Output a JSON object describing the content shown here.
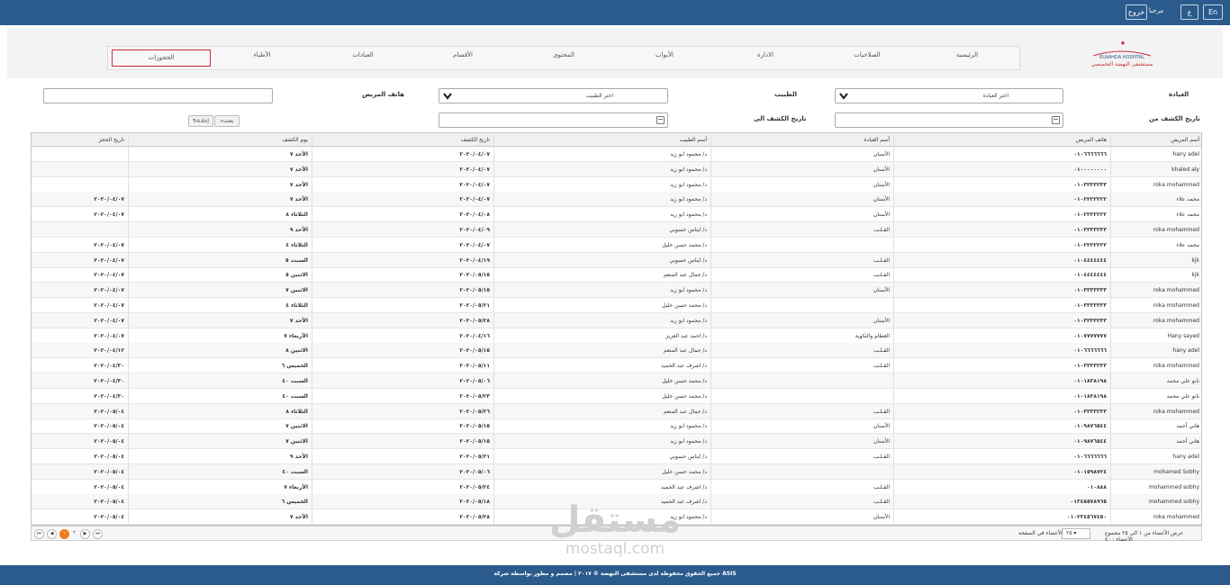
{
  "topbar": {
    "lang_en": "En",
    "lang_ar": "ع",
    "welcome": "مرحبا",
    "logout": "خروج"
  },
  "logo": {
    "text_en": "ELNAHDA HOSPITAL",
    "text_ar": "مستشفى النهضة التخصصي"
  },
  "nav": {
    "items": [
      {
        "label": "الرئيسية"
      },
      {
        "label": "الصلاحيات"
      },
      {
        "label": "الادارة"
      },
      {
        "label": "الأبواب"
      },
      {
        "label": "المحتوى"
      },
      {
        "label": "الأقسام"
      },
      {
        "label": "العيادات"
      },
      {
        "label": "الأطباء"
      },
      {
        "label": "الحجوزات"
      }
    ]
  },
  "filters": {
    "clinic_label": "العيادة",
    "clinic_value": "اختر العيادة",
    "doctor_label": "الطبيب",
    "doctor_value": "اختر الطبيب",
    "phone_label": "هاتف المريض",
    "date_from_label": "تاريخ الكشف من",
    "date_to_label": "تاريخ الكشف الى",
    "search_button": "بحث",
    "reset_button": "إعادة"
  },
  "table": {
    "columns": [
      "أسم المريض",
      "هاتف المريض",
      "أسم العيادة",
      "أسم الطبيب",
      "تاريخ الكشف",
      "يوم الكشف",
      "تاريخ الحجز"
    ],
    "rows": [
      [
        "hany adel",
        "٠١٠٦٦٦٦٦٦٦",
        "الأسنان",
        "د/ محمود ابو زيد",
        "٢٠٢٠/٠٤/٠٧",
        "الأحد ٧",
        ""
      ],
      [
        "khaled aly",
        "٠١٠٠٠٠٠٠٠٠",
        "الأسنان",
        "د/ محمود ابو زيد",
        "٢٠٢٠/٠٤/٠٧",
        "الأحد ٧",
        ""
      ],
      [
        "roka mohammed",
        "٠١٠٣٣٣٣٣٣٣",
        "الأسنان",
        "د/ محمود ابو زيد",
        "٢٠٢٠/٠٤/٠٧",
        "الأحد ٧",
        ""
      ],
      [
        "محمد علاء",
        "٠١٠٢٢٢٢٢٢٢",
        "الأسنان",
        "د/ محمود ابو زيد",
        "٢٠٢٠/٠٤/٠٧",
        "الأحد ٧",
        "٢٠٢٠/٠٤/٠٧"
      ],
      [
        "محمد علاء",
        "٠١٠٢٢٢٢٢٢٢",
        "الأسنان",
        "د/ محمود ابو زيد",
        "٢٠٢٠/٠٤/٠٨",
        "الثلاثاء ٨",
        "٢٠٢٠/٠٤/٠٧"
      ],
      [
        "roka mohammed",
        "٠١٠٣٣٣٣٣٣٣",
        "القـلـب",
        "د/ ايناس حسوبي",
        "٢٠٢٠/٠٤/٠٩",
        "الأحد ٩",
        ""
      ],
      [
        "محمد علاء",
        "٠١٠٢٢٢٢٢٢٢",
        "",
        "د/ محمد حسن خليل",
        "٢٠٢٠/٠٤/٠٧",
        "الثلاثاء ٤",
        "٢٠٢٠/٠٤/٠٧"
      ],
      [
        "kjk",
        "٠١٠٤٤٤٤٤٤٤",
        "القـلـب",
        "د/ ايناس حسوبي",
        "٢٠٢٠/٠٤/١٩",
        "السبت ٥",
        "٢٠٢٠/٠٤/٠٧"
      ],
      [
        "kjk",
        "٠١٠٤٤٤٤٤٤٤",
        "القـلـب",
        "د/ جمال عبد المنعم",
        "٢٠٢٠/٠٥/١٥",
        "الاثنين ٥",
        "٢٠٢٠/٠٤/٠٧"
      ],
      [
        "roka mohammed",
        "٠١٠٣٣٣٣٣٣٣",
        "الأسنان",
        "د/ محمود ابو زيد",
        "٢٠٢٠/٠٥/١٥",
        "الاثنين ٧",
        "٢٠٢٠/٠٤/٠٧"
      ],
      [
        "roka mohammed",
        "٠١٠٣٣٣٣٣٣٣",
        "",
        "د/ محمد حسن خليل",
        "٢٠٢٠/٠٥/٢١",
        "الثلاثاء ٤",
        "٢٠٢٠/٠٤/٠٧"
      ],
      [
        "roka mohammed",
        "٠١٠٣٣٣٣٣٣٣",
        "الأسنان",
        "د/ محمود ابو زيد",
        "٢٠٢٠/٠٥/٢٨",
        "الأحد ٧",
        "٢٠٢٠/٠٤/٠٧"
      ],
      [
        "Hany sayed",
        "٠١٠٧٧٧٧٧٧٧",
        "العظام والتكوية",
        "د/ احمد عبد العزيز",
        "٢٠٢٠/٠٤/١٦",
        "الأربعاء ٧",
        "٢٠٢٠/٠٤/٠٧"
      ],
      [
        "hany adel",
        "٠١٠٦٦٦٦٦٦٦",
        "القـلـب",
        "د/ جمال عبد المنعم",
        "٢٠٢٠/٠٥/١٥",
        "الاثنين ٨",
        "٢٠٢٠/٠٤/١٢"
      ],
      [
        "roka mohammed",
        "٠١٠٣٣٣٣٣٣٣",
        "القـلـب",
        "د/ اشرف عبد الحميد",
        "٢٠٢٠/٠٥/١١",
        "الخميس ٦",
        "٢٠٢٠/٠٤/٣٠"
      ],
      [
        "نانو علي محمد",
        "٠١٠١٨٣٨١٩٨",
        "",
        "د/ محمد حسن خليل",
        "٢٠٢٠/٠٥/٠٦",
        "السبت ٤٠",
        "٢٠٢٠/٠٤/٣٠"
      ],
      [
        "نانو علي محمد",
        "٠١٠١٨٣٨١٩٨",
        "",
        "د/ محمد حسن خليل",
        "٢٠٢٠/٠٥/٢٣",
        "السبت ٤٠",
        "٢٠٢٠/٠٤/٣٠"
      ],
      [
        "roka mohammed",
        "٠١٠٣٣٣٣٣٣٣",
        "القـلـب",
        "د/ جمال عبد المنعم",
        "٢٠٢٠/٠٥/٢٦",
        "الثلاثاء ٨",
        "٢٠٢٠/٠٥/٠٤"
      ],
      [
        "هاني أحمد",
        "٠١٠٩٨٧٦٥٤٤",
        "الأسنان",
        "د/ محمود ابو زيد",
        "٢٠٢٠/٠٥/١٥",
        "الاثنين ٧",
        "٢٠٢٠/٠٥/٠٤"
      ],
      [
        "هاني أحمد",
        "٠١٠٩٨٧٦٥٤٤",
        "الأسنان",
        "د/ محمود ابو زيد",
        "٢٠٢٠/٠٥/١٥",
        "الاثنين ٧",
        "٢٠٢٠/٠٥/٠٤"
      ],
      [
        "hany adel",
        "٠١٠٦٦٦٦٦٦٦",
        "القـلـب",
        "د/ ايناس حسوبي",
        "٢٠٢٠/٠٥/٢١",
        "الأحد ٩",
        "٢٠٢٠/٠٥/٠٤"
      ],
      [
        "mohamed Sobhy",
        "٠١٠١٥٩٨٧٢٤",
        "",
        "د/ محمد حسن خليل",
        "٢٠٢٠/٠٥/٠٦",
        "السبت ٤٠",
        "٢٠٢٠/٠٥/٠٤"
      ],
      [
        "mohammed sobhy",
        "٠١٠٨٨٨",
        "القـلـب",
        "د/ اشرف عبد الحميد",
        "٢٠٢٠/٠٥/٢٤",
        "الأربعاء ٧",
        "٢٠٢٠/٠٥/٠٤"
      ],
      [
        "mohammed sobhy",
        "٠١٣٤٥٥٧٨٩٦٥",
        "القـلـب",
        "د/ اشرف عبد الحميد",
        "٢٠٢٠/٠٥/١٨",
        "الخميس ٦",
        "٢٠٢٠/٠٥/٠٤"
      ],
      [
        "roka mohammed",
        "٠١٠٢٣٤٥٦٧٤٥٠",
        "الأسنان",
        "د/ محمود ابو زيد",
        "٢٠٢٠/٠٥/٢٨",
        "الأحد ٧",
        "٢٠٢٠/٠٥/٠٤"
      ]
    ]
  },
  "pager": {
    "summary": "عرض الأعضاء من ١ الى ٢٥ مجموع الأعضاء : ٤٠",
    "page_size": "٢٥",
    "per_page_label": "الأعضاء في الصفحة",
    "pages": [
      "١",
      "٢"
    ],
    "current_page": "١"
  },
  "watermark": {
    "ar": "مستقل",
    "en": "mostaql.com"
  },
  "footer": {
    "text": "جميع الحقوق محفوظة لدى مستشفى النهضة © ٢٠١٧ | مصمم و مطور بواسطة شركة ASIS"
  },
  "colors": {
    "primary": "#2b5b8c",
    "active_nav": "#c62d3a",
    "current_page": "#f07b1a"
  }
}
